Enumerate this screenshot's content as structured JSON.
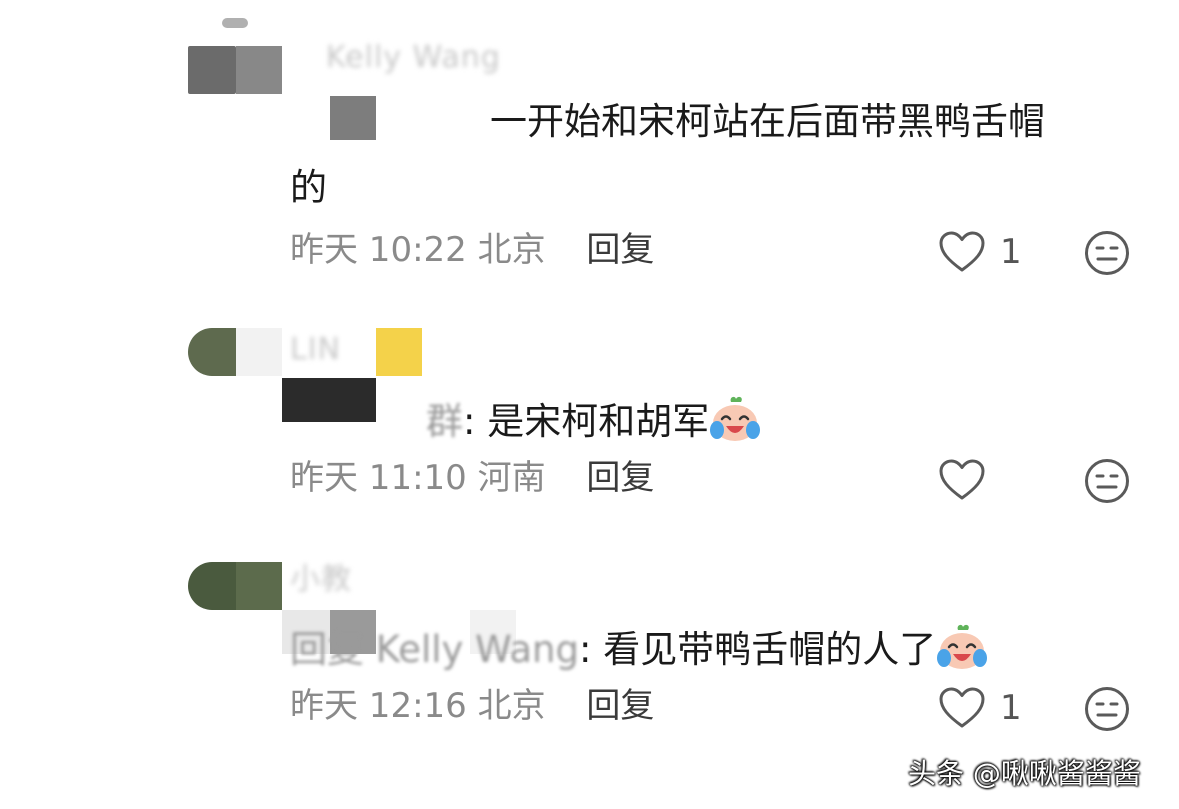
{
  "comments": [
    {
      "username": "Kelly Wang",
      "text_line1": "一开始和宋柯站在后面带黑鸭舌帽",
      "text_line2": "的",
      "time": "昨天 10:22",
      "location": "北京",
      "reply_label": "回复",
      "like_count": "1"
    },
    {
      "username": "LIN",
      "reply_prefix": "群",
      "text": ": 是宋柯和胡军",
      "time": "昨天 11:10",
      "location": "河南",
      "reply_label": "回复",
      "like_count": ""
    },
    {
      "username": "小教",
      "reply_prefix": "回复 Kelly Wang",
      "text": ": 看见带鸭舌帽的人了",
      "time": "昨天 12:16",
      "location": "北京",
      "reply_label": "回复",
      "like_count": "1"
    }
  ],
  "icons": {
    "like": "heart-outline-icon",
    "dislike": "neutral-face-icon",
    "emoji": "laughing-crying-emoji"
  },
  "colors": {
    "text": "#1a1a1a",
    "meta": "#8a8a8a",
    "icon": "#5a5a5a"
  },
  "watermark": "头条 @啾啾酱酱酱"
}
